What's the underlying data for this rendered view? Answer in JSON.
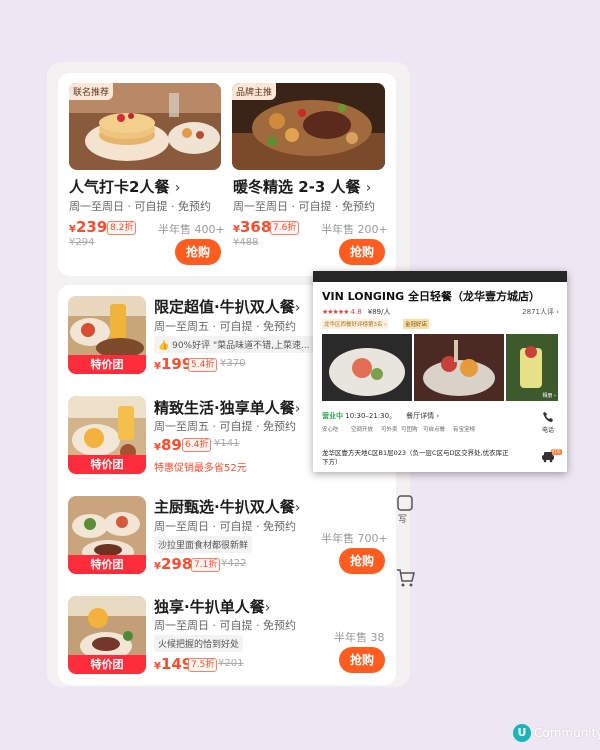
{
  "top_deals": [
    {
      "badge": "联名推荐",
      "title": "人气打卡2人餐",
      "chevron": "›",
      "sub": "周一至周日 · 可自提 · 免预约",
      "yen": "¥",
      "price": "239",
      "discount": "8.2折",
      "original": "¥294",
      "sold": "半年售 400+",
      "buy": "抢购"
    },
    {
      "badge": "品牌主推",
      "title": "暖冬精选 2-3 人餐",
      "chevron": "›",
      "sub": "周一至周日 · 可自提 · 免预约",
      "yen": "¥",
      "price": "368",
      "discount": "7.6折",
      "original": "¥488",
      "sold": "半年售 200+",
      "buy": "抢购"
    }
  ],
  "list_deals": [
    {
      "title": "限定超值·牛扒双人餐",
      "chevron": "›",
      "sub": "周一至周五 · 可自提 · 免预约",
      "review": "90%好评 \"菜品味道不错,上菜速...",
      "ribbon": "特价团",
      "yen": "¥",
      "price": "199",
      "discount": "5.4折",
      "original": "¥370"
    },
    {
      "title": "精致生活·独享单人餐",
      "chevron": "›",
      "sub": "周一至周五 · 可自提 · 免预约",
      "yen": "¥",
      "price": "89",
      "discount": "6.4折",
      "original": "¥141",
      "promo": "特惠促销最多省52元",
      "ribbon": "特价团"
    },
    {
      "title": "主厨甄选·牛扒双人餐",
      "chevron": "›",
      "sub": "周一至周日 · 可自提 · 免预约",
      "chip": "沙拉里面食材都很新鲜",
      "yen": "¥",
      "price": "298",
      "discount": "7.1折",
      "original": "¥422",
      "sold": "半年售 700+",
      "buy": "抢购",
      "ribbon": "特价团"
    },
    {
      "title": "独享·牛扒单人餐",
      "chevron": "›",
      "sub": "周一至周日 · 可自提 · 免预约",
      "chip": "火候把握的恰到好处",
      "yen": "¥",
      "price": "149",
      "discount": "7.5折",
      "original": "¥201",
      "sold": "半年售 38",
      "buy": "抢购",
      "ribbon": "特价团"
    }
  ],
  "overlay": {
    "name": "VIN LONGING 全日轻餐（龙华壹方城店）",
    "stars": "★★★★★",
    "rating": "4.8",
    "avg": "¥89/人",
    "reviews": "2871人评 ›",
    "rank": "龙华区西餐好评榜第3名 ›",
    "quality": "金冠好店",
    "album": "相册 ›",
    "status_open": "营业中",
    "hours": "10:30–21:30。",
    "detail": "餐厅详情 ›",
    "facilities": [
      "安心吃",
      "空调开放",
      "可外卖",
      "可团购",
      "可自点餐",
      "有宝宝椅"
    ],
    "phone": "电话",
    "address": "龙华区壹方天地C区B1层023（负一层C区与D区交界处,优衣库正下方）",
    "taxi": "打车"
  },
  "side": {
    "write_label": "写"
  },
  "watermark": {
    "mark": "U",
    "text": "Community"
  },
  "colors": {
    "accent": "#ff5d1f",
    "price": "#ff4b2b",
    "ribbon": "#ff2d3c",
    "open": "#2aa84f"
  }
}
